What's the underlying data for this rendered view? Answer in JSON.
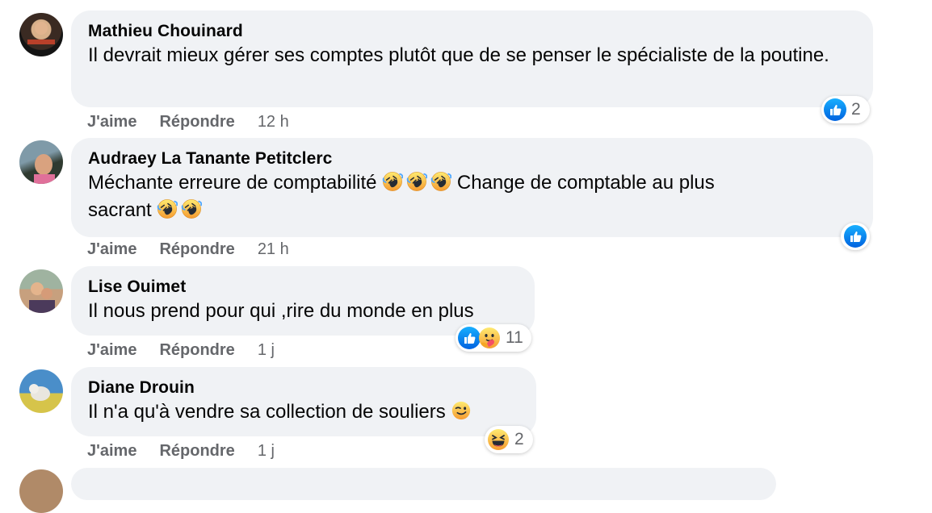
{
  "comments": [
    {
      "author": "Mathieu Chouinard",
      "text_parts": [
        "Il devrait mieux gérer ses comptes plutôt que de se penser le spécialiste de la poutine."
      ],
      "like_label": "J'aime",
      "reply_label": "Répondre",
      "time": "12 h",
      "reaction_count": "2",
      "reactions": [
        "like-icon"
      ]
    },
    {
      "author": "Audraey La Tanante Petitclerc",
      "text_parts": [
        "Méchante erreure de comptabilité",
        "Change de comptable au plus",
        "sacrant"
      ],
      "like_label": "J'aime",
      "reply_label": "Répondre",
      "time": "21 h",
      "reaction_count": "",
      "reactions": [
        "like-icon"
      ]
    },
    {
      "author": "Lise Ouimet",
      "text_parts": [
        "Il nous prend pour qui ,rire du monde en plus"
      ],
      "like_label": "J'aime",
      "reply_label": "Répondre",
      "time": "1 j",
      "reaction_count": "11",
      "reactions": [
        "like-icon",
        "care-icon"
      ]
    },
    {
      "author": "Diane Drouin",
      "text_parts": [
        "Il n'a qu'à vendre sa collection de souliers"
      ],
      "like_label": "J'aime",
      "reply_label": "Répondre",
      "time": "1 j",
      "reaction_count": "2",
      "reactions": [
        "haha-icon"
      ]
    }
  ],
  "colors": {
    "bubble": "#f0f2f5",
    "secondary_text": "#65676b",
    "like_blue": "#1877f2"
  }
}
